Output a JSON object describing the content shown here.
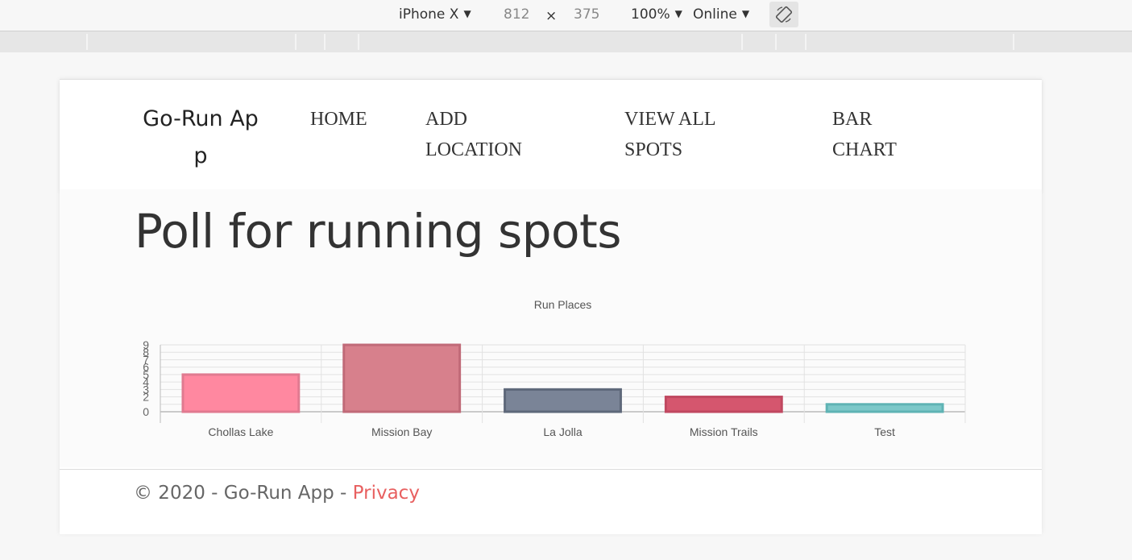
{
  "devtools": {
    "device": "iPhone X",
    "width": "812",
    "times": "×",
    "height": "375",
    "zoom": "100%",
    "network": "Online"
  },
  "nav": {
    "brand": "Go-Run App",
    "links": [
      "HOME",
      "ADD LOCATION",
      "VIEW ALL SPOTS",
      "BAR CHART"
    ]
  },
  "page": {
    "title": "Poll for running spots"
  },
  "chart_data": {
    "type": "bar",
    "title": "Run Places",
    "categories": [
      "Chollas Lake",
      "Mission Bay",
      "La Jolla",
      "Mission Trails",
      "Test"
    ],
    "values": [
      5,
      9,
      3,
      2,
      1
    ],
    "ylim": [
      0,
      9
    ],
    "yticks": [
      0,
      2,
      3,
      4,
      5,
      6,
      7,
      8,
      9
    ],
    "grid": true,
    "colors": [
      {
        "fill": "#ff88a0",
        "stroke": "#e07a90"
      },
      {
        "fill": "#d7808c",
        "stroke": "#c06a78"
      },
      {
        "fill": "#7a8497",
        "stroke": "#5e687a"
      },
      {
        "fill": "#d5566e",
        "stroke": "#c04860"
      },
      {
        "fill": "#7cc8c9",
        "stroke": "#5fb3b4"
      }
    ]
  },
  "footer": {
    "copyright": "© 2020 - Go-Run App - ",
    "privacy": "Privacy"
  }
}
